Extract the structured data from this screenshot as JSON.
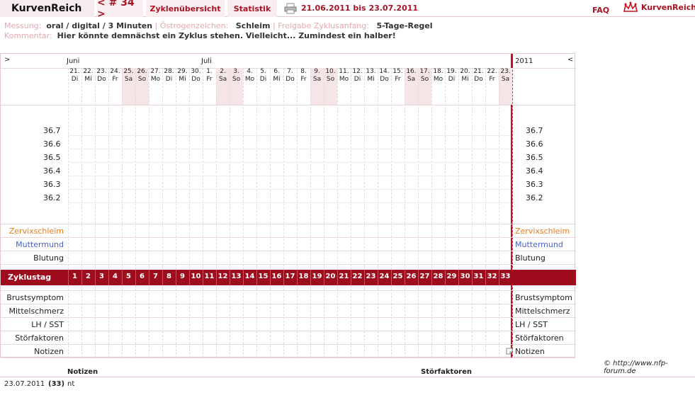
{
  "nav": {
    "brand": "KurvenReich",
    "cycle": "< # 34 >",
    "overview": "Zyklenübersicht",
    "stats": "Statistik",
    "daterange": "21.06.2011 bis 23.07.2011",
    "faq": "FAQ",
    "logo": "KurvenReich"
  },
  "info": {
    "messung_label": "Messung:",
    "messung_value": "oral / digital / 3 Minuten",
    "oestrogen_label": "Östrogenzeichen:",
    "oestrogen_value": "Schleim",
    "freigabe_label": "Freigabe Zyklusanfang:",
    "freigabe_value": "5-Tage-Regel",
    "kommentar_label": "Kommentar:",
    "kommentar_value": "Hier könnte demnächst ein Zyklus stehen. Vielleicht... Zumindest ein halber!"
  },
  "chart": {
    "nav_prev": ">",
    "nav_next": "<",
    "months": [
      {
        "name": "Juni",
        "day_index": 0
      },
      {
        "name": "Juli",
        "day_index": 10
      }
    ],
    "year": "2011",
    "days": [
      {
        "d": "21.",
        "w": "Di"
      },
      {
        "d": "22.",
        "w": "Mi"
      },
      {
        "d": "23.",
        "w": "Do"
      },
      {
        "d": "24.",
        "w": "Fr"
      },
      {
        "d": "25.",
        "w": "Sa"
      },
      {
        "d": "26.",
        "w": "So"
      },
      {
        "d": "27.",
        "w": "Mo"
      },
      {
        "d": "28.",
        "w": "Di"
      },
      {
        "d": "29.",
        "w": "Mi"
      },
      {
        "d": "30.",
        "w": "Do"
      },
      {
        "d": "1.",
        "w": "Fr"
      },
      {
        "d": "2.",
        "w": "Sa"
      },
      {
        "d": "3.",
        "w": "So"
      },
      {
        "d": "4.",
        "w": "Mo"
      },
      {
        "d": "5.",
        "w": "Di"
      },
      {
        "d": "6.",
        "w": "Mi"
      },
      {
        "d": "7.",
        "w": "Do"
      },
      {
        "d": "8.",
        "w": "Fr"
      },
      {
        "d": "9.",
        "w": "Sa"
      },
      {
        "d": "10.",
        "w": "So"
      },
      {
        "d": "11.",
        "w": "Mo"
      },
      {
        "d": "12.",
        "w": "Di"
      },
      {
        "d": "13.",
        "w": "Mi"
      },
      {
        "d": "14.",
        "w": "Do"
      },
      {
        "d": "15.",
        "w": "Fr"
      },
      {
        "d": "16.",
        "w": "Sa"
      },
      {
        "d": "17.",
        "w": "So"
      },
      {
        "d": "18.",
        "w": "Mo"
      },
      {
        "d": "19.",
        "w": "Di"
      },
      {
        "d": "20.",
        "w": "Mi"
      },
      {
        "d": "21.",
        "w": "Do"
      },
      {
        "d": "22.",
        "w": "Fr"
      },
      {
        "d": "23.",
        "w": "Sa"
      }
    ],
    "temps": [
      "36.7",
      "36.6",
      "36.5",
      "36.4",
      "36.3",
      "36.2"
    ],
    "rows_top": [
      {
        "label": "Zervixschleim",
        "color": "#e87b1c"
      },
      {
        "label": "Muttermund",
        "color": "#4a5fc4"
      },
      {
        "label": "Blutung",
        "color": "#222222"
      }
    ],
    "zyklustag_label": "Zyklustag",
    "zyklustage": [
      "1",
      "2",
      "3",
      "4",
      "5",
      "6",
      "7",
      "8",
      "9",
      "10",
      "11",
      "12",
      "13",
      "14",
      "15",
      "16",
      "17",
      "18",
      "19",
      "20",
      "21",
      "22",
      "23",
      "24",
      "25",
      "26",
      "27",
      "28",
      "29",
      "30",
      "31",
      "32",
      "33"
    ],
    "rows_bottom": [
      {
        "label": "Brustsymptom"
      },
      {
        "label": "Mittelschmerz"
      },
      {
        "label": "LH / SST"
      },
      {
        "label": "Störfaktoren"
      },
      {
        "label": "Notizen"
      }
    ],
    "weekend_color": "#f6e5e7",
    "accent": "#9e0c1e"
  },
  "copyright": "© http://www.nfp-forum.de",
  "notes_table": {
    "col_notizen": "Notizen",
    "col_stoer": "Störfaktoren",
    "rows": [
      {
        "date": "23.07.2011",
        "day": "(33)",
        "note": "nt"
      }
    ]
  }
}
